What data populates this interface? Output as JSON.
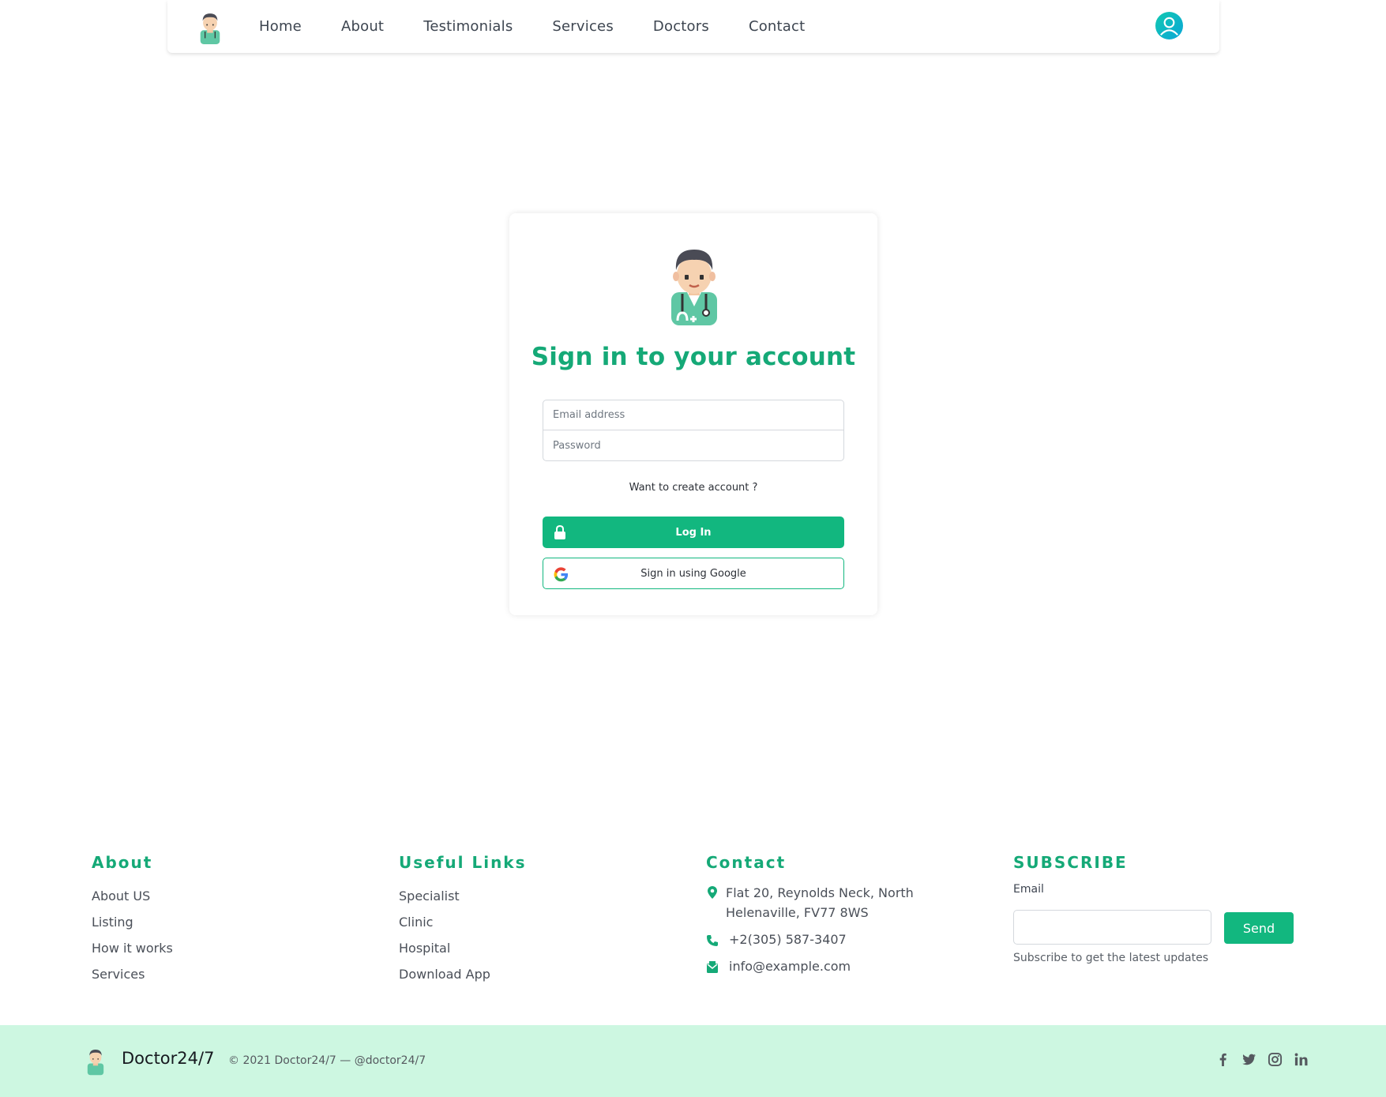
{
  "nav": {
    "items": [
      {
        "label": "Home"
      },
      {
        "label": "About"
      },
      {
        "label": "Testimonials"
      },
      {
        "label": "Services"
      },
      {
        "label": "Doctors"
      },
      {
        "label": "Contact"
      }
    ],
    "logo_icon": "doctor-avatar-icon",
    "user_icon": "user-circle-icon"
  },
  "login": {
    "title": "Sign in to your account",
    "email_placeholder": "Email address",
    "password_placeholder": "Password",
    "create_account": "Want to create account ?",
    "login_button": "Log In",
    "google_button": "Sign in using Google"
  },
  "footer": {
    "about": {
      "title": "About",
      "links": [
        "About US",
        "Listing",
        "How it works",
        "Services"
      ]
    },
    "useful": {
      "title": "Useful Links",
      "links": [
        "Specialist",
        "Clinic",
        "Hospital",
        "Download App"
      ]
    },
    "contact": {
      "title": "Contact",
      "address": "Flat 20, Reynolds Neck, North Helenaville, FV77 8WS",
      "phone": "+2(305) 587-3407",
      "email": "info@example.com"
    },
    "subscribe": {
      "title": "SUBSCRIBE",
      "label": "Email",
      "button": "Send",
      "note": "Subscribe to get the latest updates"
    },
    "bottom": {
      "brand": "Doctor24/7",
      "copyright": "© 2021 Doctor24/7 — @doctor24/7",
      "social": [
        "facebook-icon",
        "twitter-icon",
        "instagram-icon",
        "linkedin-icon"
      ]
    }
  },
  "colors": {
    "accent": "#12b77f",
    "title": "#15a977",
    "footer_bg": "#cdf7e1"
  }
}
